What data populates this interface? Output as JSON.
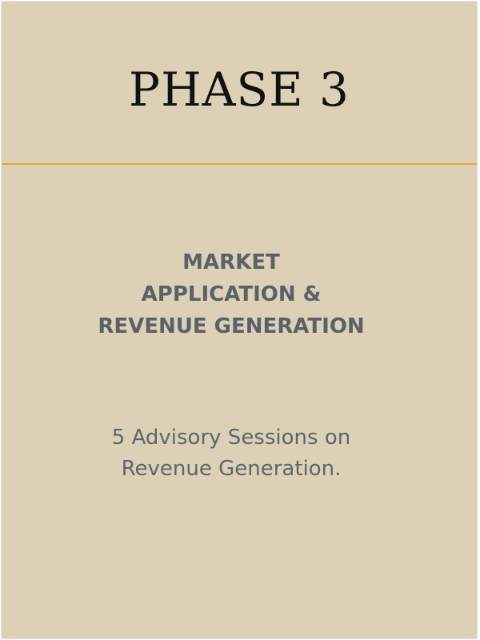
{
  "phase": {
    "title": "PHASE 3"
  },
  "heading": {
    "line1": "MARKET",
    "line2": "APPLICATION &",
    "line3": "REVENUE GENERATION"
  },
  "description": {
    "line1": "5 Advisory Sessions on",
    "line2": "Revenue Generation."
  },
  "colors": {
    "background": "#dcd0b6",
    "divider": "#e3a33b",
    "title": "#111111",
    "heading": "#5a6168",
    "body_text": "#5f656b"
  }
}
